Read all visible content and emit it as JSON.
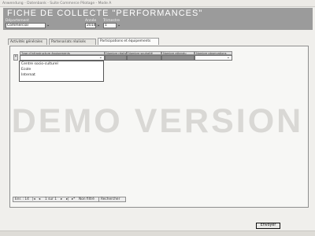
{
  "window": {
    "title": "Anwendung - Datenbank - Suite Commerce Pilotage - Mode A"
  },
  "header": {
    "title": "FICHE DE COLLECTE \"PERFORMANCES\"",
    "departement_label": "Département",
    "departement_value": "Commercial",
    "annee_label": "Année",
    "annee_value": "2014",
    "trimestre_label": "Trimestre",
    "trimestre_value": "1"
  },
  "tabs": [
    {
      "label": "Activités générales"
    },
    {
      "label": "Partenariats réalisés"
    },
    {
      "label": "Participations et équipements"
    }
  ],
  "grid": {
    "columns": [
      {
        "label": "Type d'infrastructure équipements"
      },
      {
        "label": "Nombre réalisé"
      },
      {
        "label": "Nombre souhaité"
      },
      {
        "label": "Nombre attendu"
      },
      {
        "label": "Nombre observations"
      }
    ],
    "row_selector": "*",
    "dropdown_options": [
      "Centre socio-culturel",
      "Ecole",
      "Internat"
    ]
  },
  "navigation": {
    "record_label": "Enr. : 14",
    "position": "1 sur 1",
    "filter_label": "Non filtré",
    "search_label": "Rechercher"
  },
  "watermark": "DEMO VERSION",
  "footer": {
    "send_label": "Envoyer"
  }
}
